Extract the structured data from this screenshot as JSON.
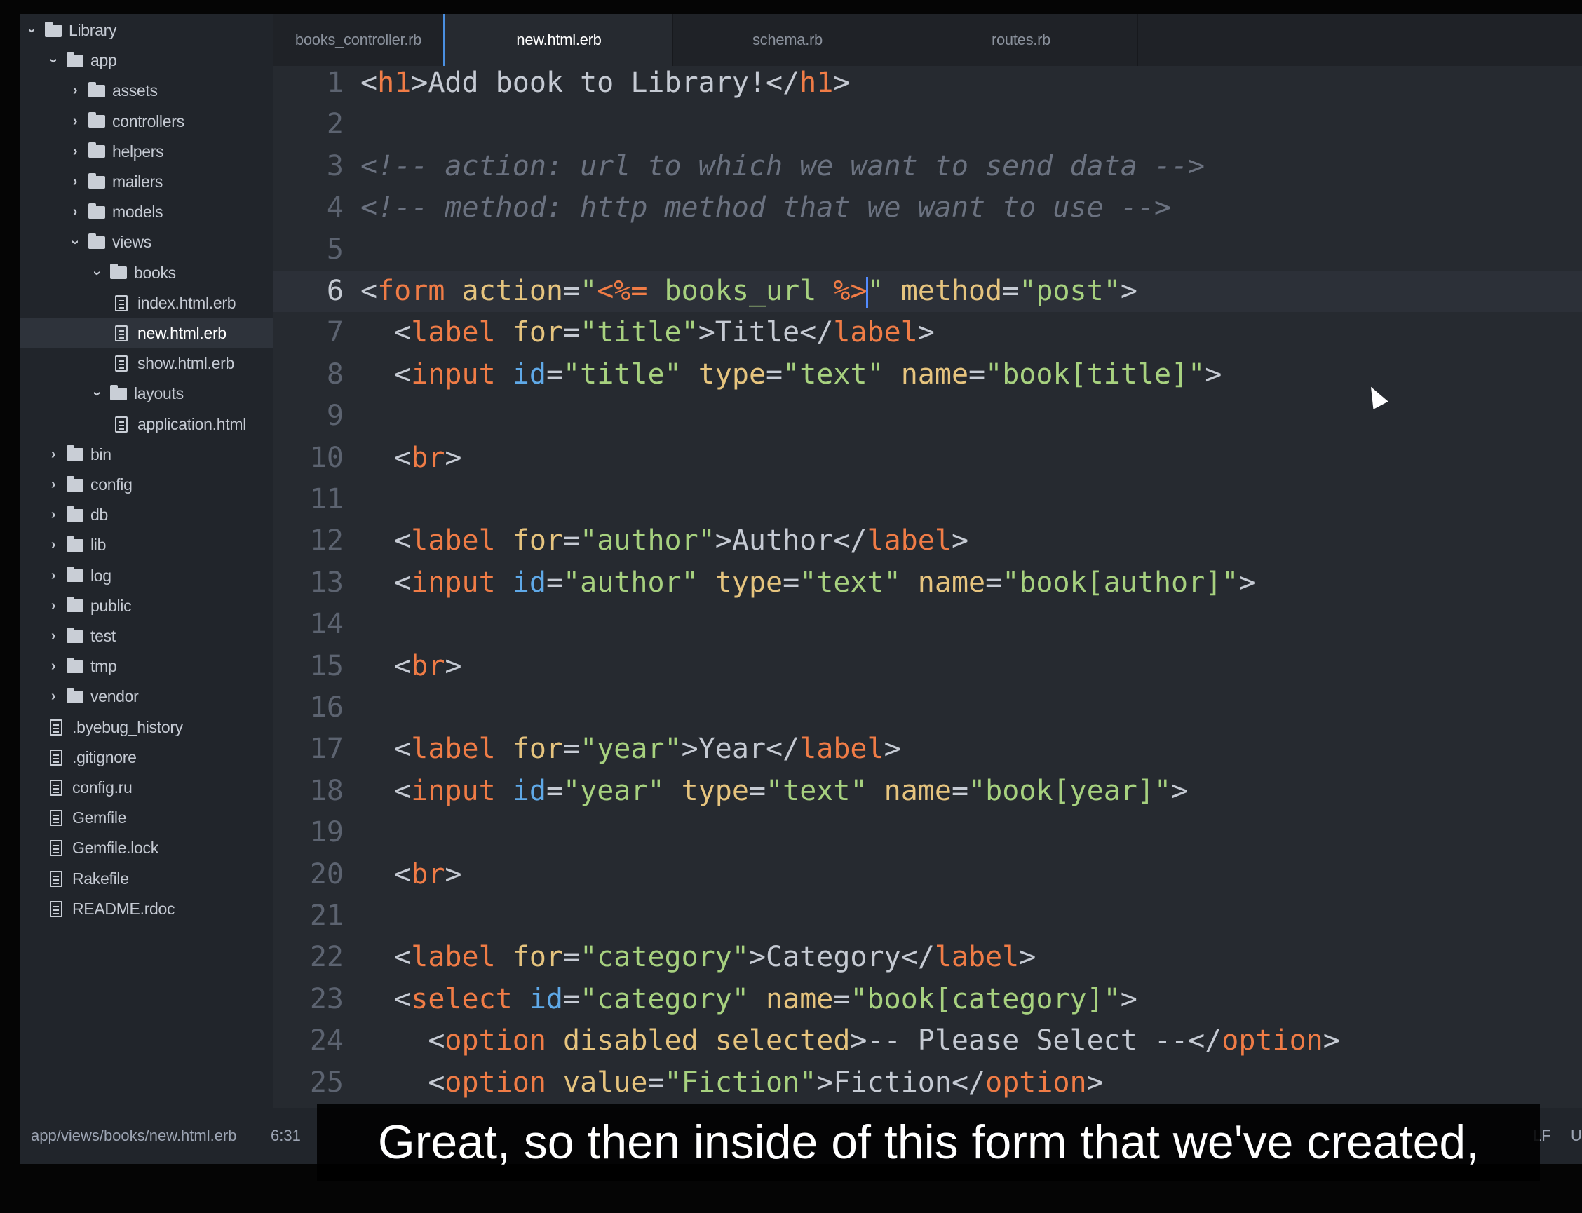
{
  "sidebar": {
    "items": [
      {
        "label": "Library",
        "type": "folder",
        "depth": 0,
        "open": true
      },
      {
        "label": "app",
        "type": "folder",
        "depth": 1,
        "open": true
      },
      {
        "label": "assets",
        "type": "folder",
        "depth": 2,
        "open": false
      },
      {
        "label": "controllers",
        "type": "folder",
        "depth": 2,
        "open": false
      },
      {
        "label": "helpers",
        "type": "folder",
        "depth": 2,
        "open": false
      },
      {
        "label": "mailers",
        "type": "folder",
        "depth": 2,
        "open": false
      },
      {
        "label": "models",
        "type": "folder",
        "depth": 2,
        "open": false
      },
      {
        "label": "views",
        "type": "folder",
        "depth": 2,
        "open": true
      },
      {
        "label": "books",
        "type": "folder",
        "depth": 3,
        "open": true
      },
      {
        "label": "index.html.erb",
        "type": "file",
        "depth": 4
      },
      {
        "label": "new.html.erb",
        "type": "file",
        "depth": 4,
        "selected": true
      },
      {
        "label": "show.html.erb",
        "type": "file",
        "depth": 4
      },
      {
        "label": "layouts",
        "type": "folder",
        "depth": 3,
        "open": true
      },
      {
        "label": "application.html",
        "type": "file",
        "depth": 4
      },
      {
        "label": "bin",
        "type": "folder",
        "depth": 1,
        "open": false
      },
      {
        "label": "config",
        "type": "folder",
        "depth": 1,
        "open": false
      },
      {
        "label": "db",
        "type": "folder",
        "depth": 1,
        "open": false
      },
      {
        "label": "lib",
        "type": "folder",
        "depth": 1,
        "open": false
      },
      {
        "label": "log",
        "type": "folder",
        "depth": 1,
        "open": false
      },
      {
        "label": "public",
        "type": "folder",
        "depth": 1,
        "open": false
      },
      {
        "label": "test",
        "type": "folder",
        "depth": 1,
        "open": false
      },
      {
        "label": "tmp",
        "type": "folder",
        "depth": 1,
        "open": false
      },
      {
        "label": "vendor",
        "type": "folder",
        "depth": 1,
        "open": false
      },
      {
        "label": ".byebug_history",
        "type": "file",
        "depth": 1
      },
      {
        "label": ".gitignore",
        "type": "file",
        "depth": 1
      },
      {
        "label": "config.ru",
        "type": "file",
        "depth": 1
      },
      {
        "label": "Gemfile",
        "type": "file",
        "depth": 1
      },
      {
        "label": "Gemfile.lock",
        "type": "file",
        "depth": 1
      },
      {
        "label": "Rakefile",
        "type": "file",
        "depth": 1
      },
      {
        "label": "README.rdoc",
        "type": "file",
        "depth": 1
      }
    ]
  },
  "tabs": [
    {
      "label": "books_controller.rb",
      "active": false
    },
    {
      "label": "new.html.erb",
      "active": true
    },
    {
      "label": "schema.rb",
      "active": false
    },
    {
      "label": "routes.rb",
      "active": false
    }
  ],
  "editor": {
    "current_line": 6,
    "lines": [
      [
        [
          "p",
          "<"
        ],
        [
          "t",
          "h1"
        ],
        [
          "p",
          ">Add book to Library!</"
        ],
        [
          "t",
          "h1"
        ],
        [
          "p",
          ">"
        ]
      ],
      [],
      [
        [
          "c",
          "<!-- action: url to which we want to send data -->"
        ]
      ],
      [
        [
          "c",
          "<!-- method: http method that we want to use -->"
        ]
      ],
      [],
      [
        [
          "p",
          "<"
        ],
        [
          "t",
          "form"
        ],
        [
          "p",
          " "
        ],
        [
          "a",
          "action"
        ],
        [
          "p",
          "="
        ],
        [
          "s",
          "\""
        ],
        [
          "e",
          "<%="
        ],
        [
          "s",
          " books_url "
        ],
        [
          "e",
          "%>"
        ],
        [
          "cursor",
          ""
        ],
        [
          "s",
          "\""
        ],
        [
          "p",
          " "
        ],
        [
          "a",
          "method"
        ],
        [
          "p",
          "="
        ],
        [
          "s",
          "\"post\""
        ],
        [
          "p",
          ">"
        ]
      ],
      [
        [
          "p",
          "  <"
        ],
        [
          "t",
          "label"
        ],
        [
          "p",
          " "
        ],
        [
          "a",
          "for"
        ],
        [
          "p",
          "="
        ],
        [
          "s",
          "\"title\""
        ],
        [
          "p",
          ">Title</"
        ],
        [
          "t",
          "label"
        ],
        [
          "p",
          ">"
        ]
      ],
      [
        [
          "p",
          "  <"
        ],
        [
          "t",
          "input"
        ],
        [
          "p",
          " "
        ],
        [
          "i",
          "id"
        ],
        [
          "p",
          "="
        ],
        [
          "s",
          "\"title\""
        ],
        [
          "p",
          " "
        ],
        [
          "a",
          "type"
        ],
        [
          "p",
          "="
        ],
        [
          "s",
          "\"text\""
        ],
        [
          "p",
          " "
        ],
        [
          "a",
          "name"
        ],
        [
          "p",
          "="
        ],
        [
          "s",
          "\"book[title]\""
        ],
        [
          "p",
          ">"
        ]
      ],
      [],
      [
        [
          "p",
          "  <"
        ],
        [
          "t",
          "br"
        ],
        [
          "p",
          ">"
        ]
      ],
      [],
      [
        [
          "p",
          "  <"
        ],
        [
          "t",
          "label"
        ],
        [
          "p",
          " "
        ],
        [
          "a",
          "for"
        ],
        [
          "p",
          "="
        ],
        [
          "s",
          "\"author\""
        ],
        [
          "p",
          ">Author</"
        ],
        [
          "t",
          "label"
        ],
        [
          "p",
          ">"
        ]
      ],
      [
        [
          "p",
          "  <"
        ],
        [
          "t",
          "input"
        ],
        [
          "p",
          " "
        ],
        [
          "i",
          "id"
        ],
        [
          "p",
          "="
        ],
        [
          "s",
          "\"author\""
        ],
        [
          "p",
          " "
        ],
        [
          "a",
          "type"
        ],
        [
          "p",
          "="
        ],
        [
          "s",
          "\"text\""
        ],
        [
          "p",
          " "
        ],
        [
          "a",
          "name"
        ],
        [
          "p",
          "="
        ],
        [
          "s",
          "\"book[author]\""
        ],
        [
          "p",
          ">"
        ]
      ],
      [],
      [
        [
          "p",
          "  <"
        ],
        [
          "t",
          "br"
        ],
        [
          "p",
          ">"
        ]
      ],
      [],
      [
        [
          "p",
          "  <"
        ],
        [
          "t",
          "label"
        ],
        [
          "p",
          " "
        ],
        [
          "a",
          "for"
        ],
        [
          "p",
          "="
        ],
        [
          "s",
          "\"year\""
        ],
        [
          "p",
          ">Year</"
        ],
        [
          "t",
          "label"
        ],
        [
          "p",
          ">"
        ]
      ],
      [
        [
          "p",
          "  <"
        ],
        [
          "t",
          "input"
        ],
        [
          "p",
          " "
        ],
        [
          "i",
          "id"
        ],
        [
          "p",
          "="
        ],
        [
          "s",
          "\"year\""
        ],
        [
          "p",
          " "
        ],
        [
          "a",
          "type"
        ],
        [
          "p",
          "="
        ],
        [
          "s",
          "\"text\""
        ],
        [
          "p",
          " "
        ],
        [
          "a",
          "name"
        ],
        [
          "p",
          "="
        ],
        [
          "s",
          "\"book[year]\""
        ],
        [
          "p",
          ">"
        ]
      ],
      [],
      [
        [
          "p",
          "  <"
        ],
        [
          "t",
          "br"
        ],
        [
          "p",
          ">"
        ]
      ],
      [],
      [
        [
          "p",
          "  <"
        ],
        [
          "t",
          "label"
        ],
        [
          "p",
          " "
        ],
        [
          "a",
          "for"
        ],
        [
          "p",
          "="
        ],
        [
          "s",
          "\"category\""
        ],
        [
          "p",
          ">Category</"
        ],
        [
          "t",
          "label"
        ],
        [
          "p",
          ">"
        ]
      ],
      [
        [
          "p",
          "  <"
        ],
        [
          "t",
          "select"
        ],
        [
          "p",
          " "
        ],
        [
          "i",
          "id"
        ],
        [
          "p",
          "="
        ],
        [
          "s",
          "\"category\""
        ],
        [
          "p",
          " "
        ],
        [
          "a",
          "name"
        ],
        [
          "p",
          "="
        ],
        [
          "s",
          "\"book[category]\""
        ],
        [
          "p",
          ">"
        ]
      ],
      [
        [
          "p",
          "    <"
        ],
        [
          "t",
          "option"
        ],
        [
          "p",
          " "
        ],
        [
          "a",
          "disabled"
        ],
        [
          "p",
          " "
        ],
        [
          "a",
          "selected"
        ],
        [
          "p",
          ">-- Please Select --</"
        ],
        [
          "t",
          "option"
        ],
        [
          "p",
          ">"
        ]
      ],
      [
        [
          "p",
          "    <"
        ],
        [
          "t",
          "option"
        ],
        [
          "p",
          " "
        ],
        [
          "a",
          "value"
        ],
        [
          "p",
          "="
        ],
        [
          "s",
          "\"Fiction\""
        ],
        [
          "p",
          ">Fiction</"
        ],
        [
          "t",
          "option"
        ],
        [
          "p",
          ">"
        ]
      ]
    ]
  },
  "statusbar": {
    "file_path": "app/views/books/new.html.erb",
    "cursor_position": "6:31",
    "line_ending": "LF",
    "encoding_partial": "U"
  },
  "subtitle": {
    "text": "Great, so then inside of this form that we've created,"
  },
  "colors": {
    "tag": "#f07c46",
    "attribute": "#e6c47e",
    "id_attribute": "#5fa9e8",
    "string": "#a7d17f",
    "comment": "#6b7280",
    "text": "#c5cad3",
    "cursor": "#528bff"
  }
}
